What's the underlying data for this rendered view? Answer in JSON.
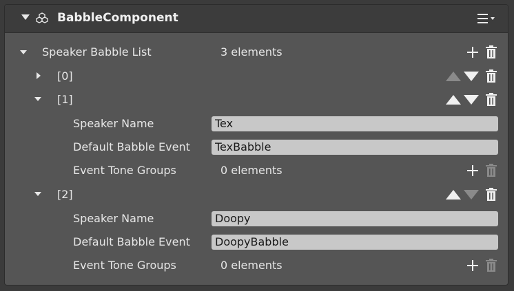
{
  "component": {
    "title": "BabbleComponent"
  },
  "list": {
    "label": "Speaker Babble List",
    "count": "3 elements",
    "items": [
      {
        "index": "[0]"
      },
      {
        "index": "[1]",
        "speaker_name_label": "Speaker Name",
        "speaker_name": "Tex",
        "default_event_label": "Default Babble Event",
        "default_event": "TexBabble",
        "tone_groups_label": "Event Tone Groups",
        "tone_groups_count": "0 elements"
      },
      {
        "index": "[2]",
        "speaker_name_label": "Speaker Name",
        "speaker_name": "Doopy",
        "default_event_label": "Default Babble Event",
        "default_event": "DoopyBabble",
        "tone_groups_label": "Event Tone Groups",
        "tone_groups_count": "0 elements"
      }
    ]
  },
  "colors": {
    "panel": "#555555",
    "header": "#3c3c3c",
    "field": "#c8c8c8",
    "icon": "#f0f0f0",
    "icon_disabled": "#8a8a8a"
  }
}
